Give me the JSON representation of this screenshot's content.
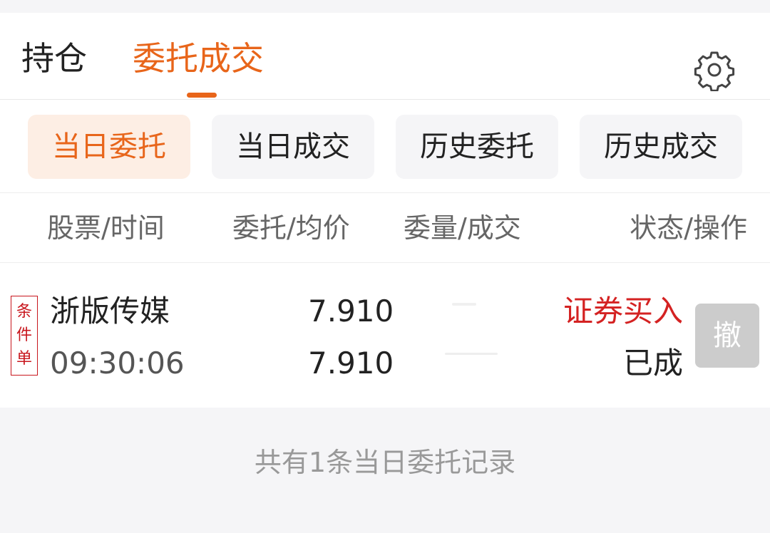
{
  "tabs": {
    "holdings": "持仓",
    "orders_trades": "委托成交",
    "active": "委托成交",
    "settings_icon": "gear-icon"
  },
  "subtabs": {
    "items": [
      "当日委托",
      "当日成交",
      "历史委托",
      "历史成交"
    ],
    "active": "当日委托"
  },
  "columns": {
    "stock_time": "股票/时间",
    "price_avg": "委托/均价",
    "qty_filled": "委量/成交",
    "status_action": "状态/操作"
  },
  "order": {
    "tag_chars": [
      "条",
      "件",
      "单"
    ],
    "stock_name": "浙版传媒",
    "time": "09:30:06",
    "order_price": "7.910",
    "avg_price": "7.910",
    "side": "证券买入",
    "status": "已成",
    "cancel_label": "撤"
  },
  "footer": {
    "summary": "共有1条当日委托记录"
  },
  "colors": {
    "accent": "#e8651a",
    "buy_red": "#d42222",
    "tag_red": "#c8161d",
    "disabled_gray": "#cccccc"
  }
}
